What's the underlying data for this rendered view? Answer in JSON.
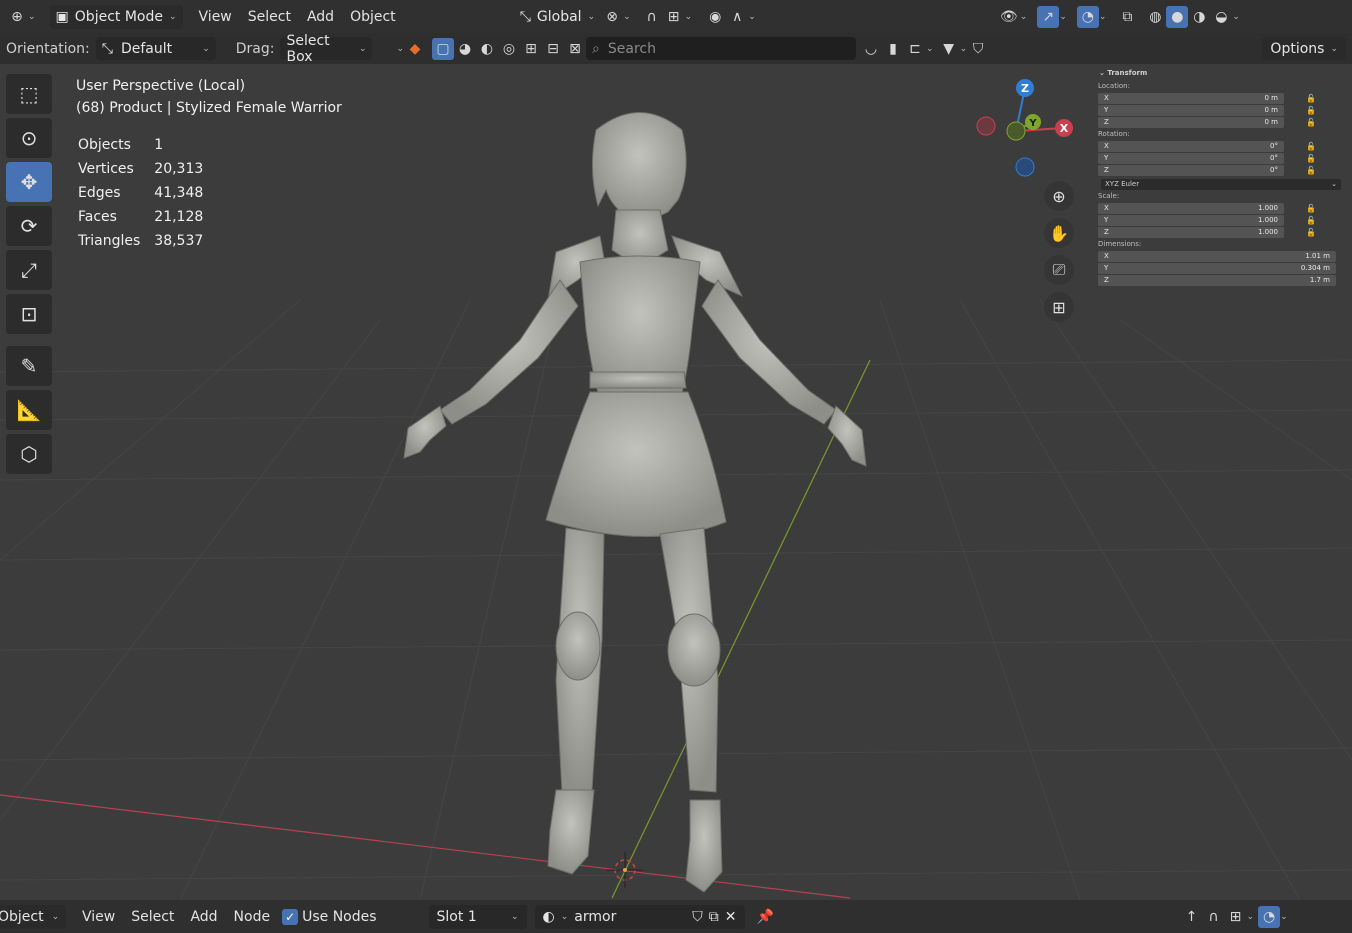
{
  "header": {
    "mode": "Object Mode",
    "menus": [
      "View",
      "Select",
      "Add",
      "Object"
    ],
    "transform_orientation": "Global"
  },
  "tool_settings": {
    "orientation_label": "Orientation:",
    "orientation_value": "Default",
    "drag_label": "Drag:",
    "drag_value": "Select Box",
    "search_placeholder": "Search",
    "options_label": "Options"
  },
  "viewport": {
    "view_name": "User Perspective (Local)",
    "object_line": "(68) Product | Stylized Female Warrior",
    "stats": [
      {
        "label": "Objects",
        "value": "1"
      },
      {
        "label": "Vertices",
        "value": "20,313"
      },
      {
        "label": "Edges",
        "value": "41,348"
      },
      {
        "label": "Faces",
        "value": "21,128"
      },
      {
        "label": "Triangles",
        "value": "38,537"
      }
    ],
    "gizmo": {
      "x": "X",
      "y": "Y",
      "z": "Z"
    },
    "colors": {
      "x_axis": "#c8404f",
      "y_axis": "#7fa62c",
      "z_axis": "#2e7dd6",
      "active_tool": "#4772b3",
      "model": "#a8a8a2"
    }
  },
  "npanel": {
    "title": "Transform",
    "location_label": "Location:",
    "location": [
      {
        "axis": "X",
        "value": "0 m"
      },
      {
        "axis": "Y",
        "value": "0 m"
      },
      {
        "axis": "Z",
        "value": "0 m"
      }
    ],
    "rotation_label": "Rotation:",
    "rotation": [
      {
        "axis": "X",
        "value": "0°"
      },
      {
        "axis": "Y",
        "value": "0°"
      },
      {
        "axis": "Z",
        "value": "0°"
      }
    ],
    "rotation_mode": "XYZ Euler",
    "scale_label": "Scale:",
    "scale": [
      {
        "axis": "X",
        "value": "1.000"
      },
      {
        "axis": "Y",
        "value": "1.000"
      },
      {
        "axis": "Z",
        "value": "1.000"
      }
    ],
    "dimensions_label": "Dimensions:",
    "dimensions": [
      {
        "axis": "X",
        "value": "1.01 m"
      },
      {
        "axis": "Y",
        "value": "0.304 m"
      },
      {
        "axis": "Z",
        "value": "1.7 m"
      }
    ]
  },
  "bottom": {
    "mode": "Object",
    "menus": [
      "View",
      "Select",
      "Add",
      "Node"
    ],
    "use_nodes_label": "Use Nodes",
    "slot": "Slot 1",
    "material": "armor"
  }
}
